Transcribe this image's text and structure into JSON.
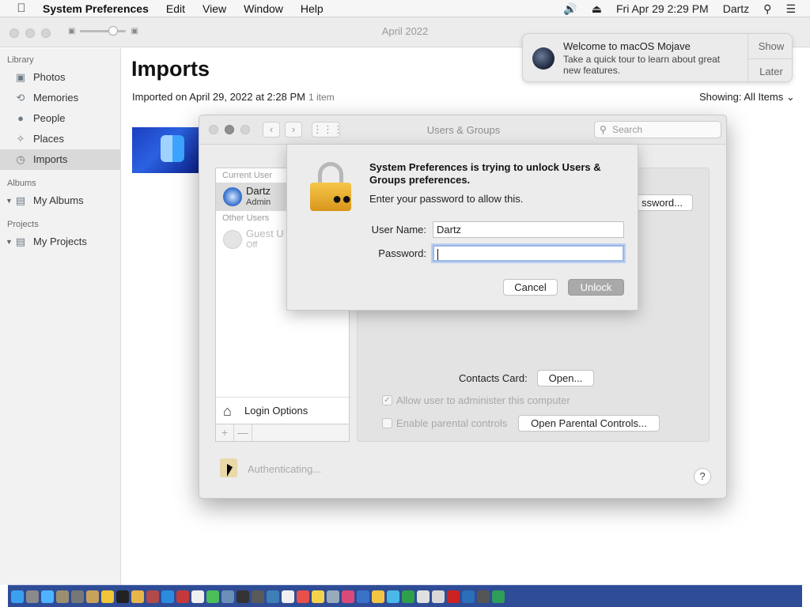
{
  "menubar": {
    "apple_icon": "apple-icon",
    "app_name": "System Preferences",
    "items": [
      "Edit",
      "View",
      "Window",
      "Help"
    ],
    "clock": "Fri Apr 29  2:29 PM",
    "user": "Dartz"
  },
  "photos": {
    "window_title": "April 2022",
    "sidebar": {
      "library_label": "Library",
      "library_items": [
        "Photos",
        "Memories",
        "People",
        "Places",
        "Imports"
      ],
      "albums_label": "Albums",
      "albums_item": "My Albums",
      "projects_label": "Projects",
      "projects_item": "My Projects"
    },
    "title": "Imports",
    "subtitle": "Imported on April 29, 2022 at 2:28 PM",
    "item_count": "1 item",
    "showing_label": "Showing:",
    "showing_value": "All Items"
  },
  "notification": {
    "title": "Welcome to macOS Mojave",
    "body": "Take a quick tour to learn about great new features.",
    "show_label": "Show",
    "later_label": "Later"
  },
  "users_groups": {
    "title": "Users & Groups",
    "search_placeholder": "Search",
    "current_user_label": "Current User",
    "current_user_name": "Dartz",
    "current_user_role": "Admin",
    "other_users_label": "Other Users",
    "guest_name": "Guest U",
    "guest_status": "Off",
    "login_options": "Login Options",
    "add_label": "+",
    "remove_label": "—",
    "password_button": "ssword...",
    "contacts_card_label": "Contacts Card:",
    "open_button": "Open...",
    "allow_admin_label": "Allow user to administer this computer",
    "parental_label": "Enable parental controls",
    "open_parental_button": "Open Parental Controls...",
    "authenticating": "Authenticating...",
    "help_label": "?"
  },
  "auth_sheet": {
    "message": "System Preferences is trying to unlock Users & Groups preferences.",
    "prompt": "Enter your password to allow this.",
    "username_label": "User Name:",
    "username_value": "Dartz",
    "password_label": "Password:",
    "password_value": "",
    "cancel_label": "Cancel",
    "unlock_label": "Unlock"
  },
  "colors": {
    "dock": "#2f4c96",
    "unlock_disabled": "#a9a9a9",
    "focus_ring": "#9db8e6"
  }
}
